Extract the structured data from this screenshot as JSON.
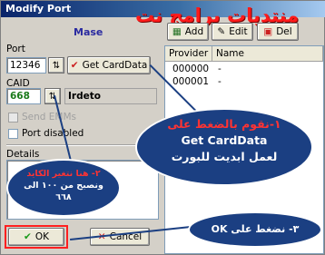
{
  "window": {
    "title": "Modify Port"
  },
  "watermark": "منتديات برامج نت",
  "section_label": "Mase",
  "port": {
    "label": "Port",
    "value": "12346"
  },
  "get_card_button": "Get CardData",
  "caid": {
    "label": "CAID",
    "value": "668",
    "provider_name": "Irdeto"
  },
  "send_emms": "Send EMMs",
  "port_disabled": "Port disabled",
  "details_label": "Details",
  "toolbar": {
    "add": "Add",
    "edit": "Edit",
    "del": "Del"
  },
  "list": {
    "columns": [
      "Provider",
      "Name"
    ],
    "rows": [
      {
        "provider": "000000",
        "name": "-"
      },
      {
        "provider": "000001",
        "name": "-"
      }
    ]
  },
  "buttons": {
    "ok": "OK",
    "cancel": "Cancel"
  },
  "callouts": {
    "c1_line1": "١-نقوم بالضغط على",
    "c1_line2": "Get CardData",
    "c1_line3": "لعمل ابديت للبورت",
    "c2_line1": "٢- هنا نتغير الكايد",
    "c2_line2": "ونصبح من ١٠٠ الى",
    "c2_line3": "٦٦٨",
    "c3_text": "٣- نضغط على OK"
  },
  "colors": {
    "callout_bg": "#1b3f82",
    "highlight": "#ff2020",
    "watermark": "#ff1a1a"
  }
}
